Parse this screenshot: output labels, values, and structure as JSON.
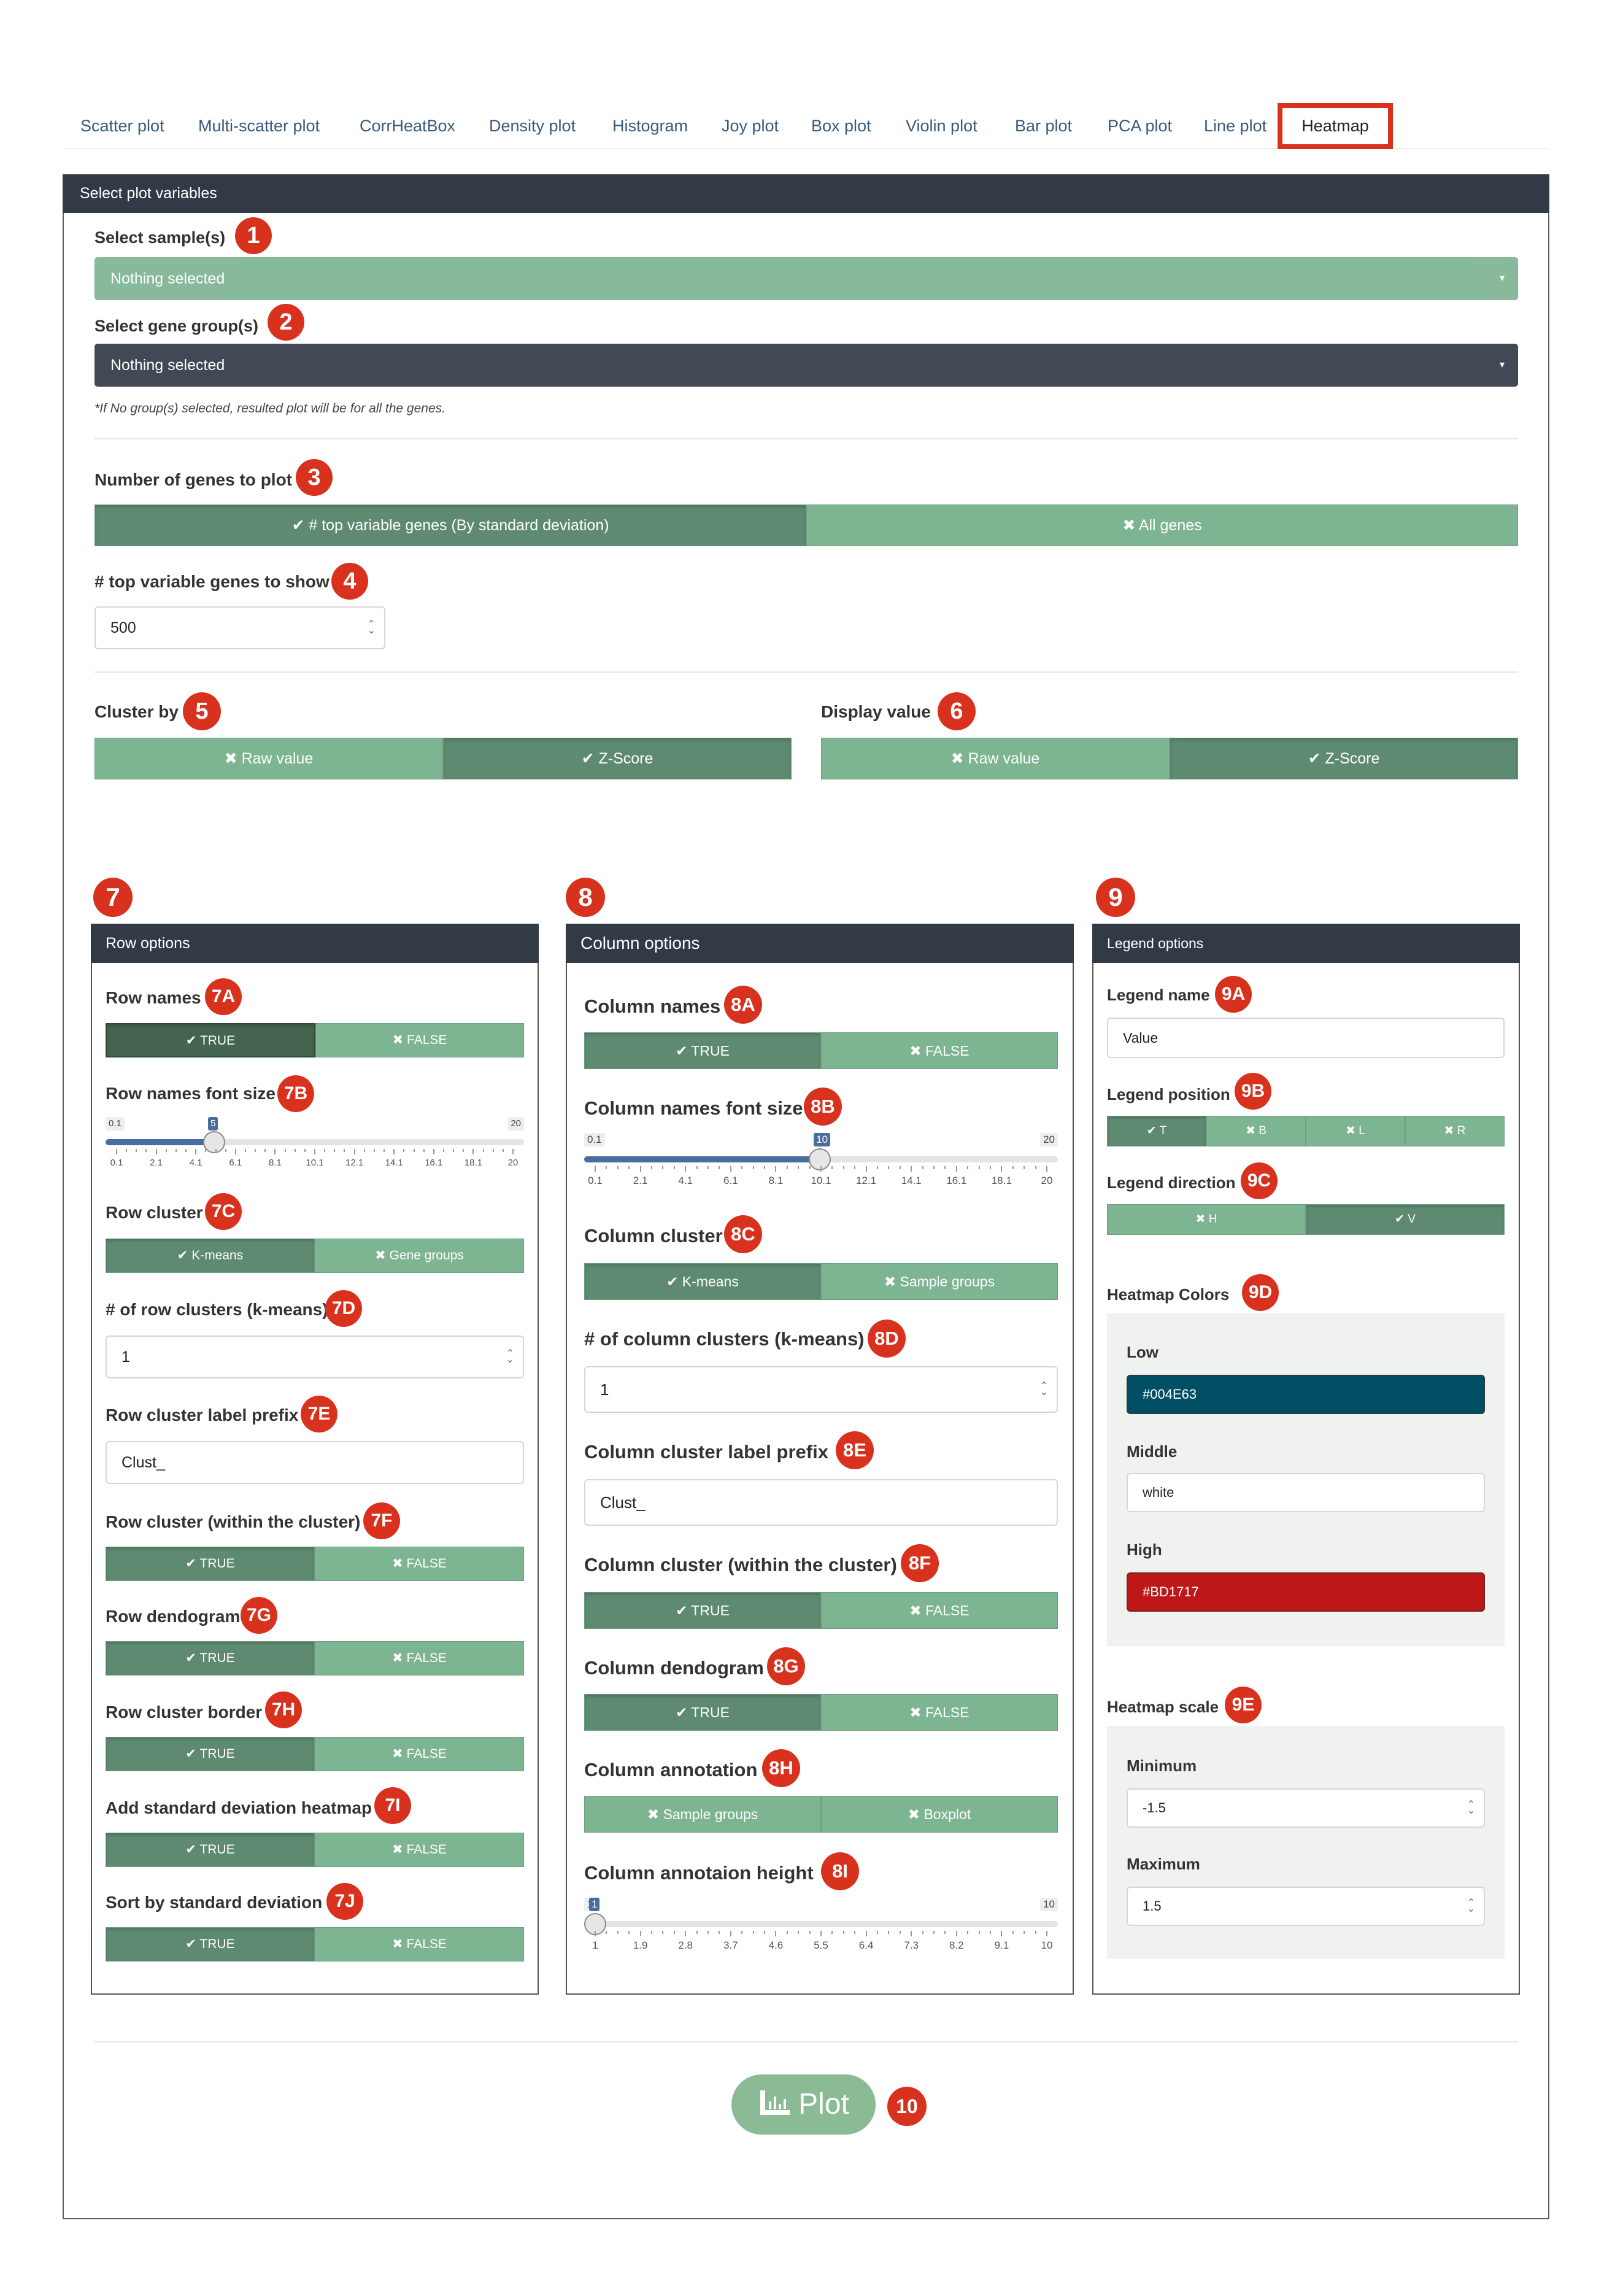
{
  "tabs": [
    "Scatter plot",
    "Multi-scatter plot",
    "CorrHeatBox",
    "Density plot",
    "Histogram",
    "Joy plot",
    "Box plot",
    "Violin plot",
    "Bar plot",
    "PCA plot",
    "Line plot",
    "Heatmap"
  ],
  "active_tab": "Heatmap",
  "panel_title": "Select plot variables",
  "samples": {
    "label": "Select sample(s)",
    "value": "Nothing selected",
    "badge": "1"
  },
  "gene_groups": {
    "label": "Select gene group(s)",
    "value": "Nothing selected",
    "badge": "2",
    "note": "*If No group(s) selected, resulted plot will be for all the genes."
  },
  "num_genes": {
    "label": "Number of genes to plot",
    "badge": "3",
    "options": [
      "✔ # top variable genes (By standard deviation)",
      "✖ All genes"
    ]
  },
  "top_genes": {
    "label": "# top variable genes to show",
    "badge": "4",
    "value": "500"
  },
  "cluster_by": {
    "label": "Cluster by",
    "badge": "5",
    "options": [
      "✖ Raw value",
      "✔ Z-Score"
    ]
  },
  "display_value": {
    "label": "Display value",
    "badge": "6",
    "options": [
      "✖ Raw value",
      "✔ Z-Score"
    ]
  },
  "row_options": {
    "badge": "7",
    "title": "Row options",
    "row_names": {
      "label": "Row names",
      "badge": "7A",
      "options": [
        "✔ TRUE",
        "✖ FALSE"
      ]
    },
    "font_size": {
      "label": "Row names font size",
      "badge": "7B",
      "min": "0.1",
      "max": "20",
      "value": "5",
      "value_num": 5,
      "ticks": [
        "0.1",
        "2.1",
        "4.1",
        "6.1",
        "8.1",
        "10.1",
        "12.1",
        "14.1",
        "16.1",
        "18.1",
        "20"
      ]
    },
    "row_cluster": {
      "label": "Row cluster",
      "badge": "7C",
      "options": [
        "✔ K-means",
        "✖ Gene groups"
      ]
    },
    "num_clusters": {
      "label": "# of row clusters (k-means)",
      "badge": "7D",
      "value": "1"
    },
    "prefix": {
      "label": "Row cluster label prefix",
      "badge": "7E",
      "value": "Clust_"
    },
    "within": {
      "label": "Row cluster (within the cluster)",
      "badge": "7F",
      "options": [
        "✔ TRUE",
        "✖ FALSE"
      ]
    },
    "dendogram": {
      "label": "Row dendogram",
      "badge": "7G",
      "options": [
        "✔ TRUE",
        "✖ FALSE"
      ]
    },
    "border": {
      "label": "Row cluster border",
      "badge": "7H",
      "options": [
        "✔ TRUE",
        "✖ FALSE"
      ]
    },
    "sd_heatmap": {
      "label": "Add standard deviation heatmap",
      "badge": "7I",
      "options": [
        "✔ TRUE",
        "✖ FALSE"
      ]
    },
    "sort_sd": {
      "label": "Sort by standard deviation",
      "badge": "7J",
      "options": [
        "✔ TRUE",
        "✖ FALSE"
      ]
    }
  },
  "column_options": {
    "badge": "8",
    "title": "Column options",
    "col_names": {
      "label": "Column names",
      "badge": "8A",
      "options": [
        "✔ TRUE",
        "✖ FALSE"
      ]
    },
    "font_size": {
      "label": "Column names font size",
      "badge": "8B",
      "min": "0.1",
      "max": "20",
      "value": "10",
      "value_num": 10,
      "ticks": [
        "0.1",
        "2.1",
        "4.1",
        "6.1",
        "8.1",
        "10.1",
        "12.1",
        "14.1",
        "16.1",
        "18.1",
        "20"
      ]
    },
    "col_cluster": {
      "label": "Column cluster",
      "badge": "8C",
      "options": [
        "✔ K-means",
        "✖ Sample groups"
      ]
    },
    "num_clusters": {
      "label": "# of column clusters (k-means)",
      "badge": "8D",
      "value": "1"
    },
    "prefix": {
      "label": "Column cluster label prefix",
      "badge": "8E",
      "value": "Clust_"
    },
    "within": {
      "label": "Column cluster (within the cluster)",
      "badge": "8F",
      "options": [
        "✔ TRUE",
        "✖ FALSE"
      ]
    },
    "dendogram": {
      "label": "Column dendogram",
      "badge": "8G",
      "options": [
        "✔ TRUE",
        "✖ FALSE"
      ]
    },
    "annotation": {
      "label": "Column annotation",
      "badge": "8H",
      "options": [
        "✖ Sample groups",
        "✖ Boxplot"
      ]
    },
    "annot_height": {
      "label": "Column annotaion height",
      "badge": "8I",
      "min": "1",
      "max": "10",
      "value": "1",
      "value_num": 1,
      "ticks": [
        "1",
        "1.9",
        "2.8",
        "3.7",
        "4.6",
        "5.5",
        "6.4",
        "7.3",
        "8.2",
        "9.1",
        "10"
      ]
    }
  },
  "legend_options": {
    "badge": "9",
    "title": "Legend options",
    "name": {
      "label": "Legend name",
      "badge": "9A",
      "value": "Value"
    },
    "position": {
      "label": "Legend position",
      "badge": "9B",
      "options": [
        "✔ T",
        "✖ B",
        "✖ L",
        "✖ R"
      ]
    },
    "direction": {
      "label": "Legend direction",
      "badge": "9C",
      "options": [
        "✖ H",
        "✔ V"
      ]
    },
    "colors": {
      "label": "Heatmap Colors",
      "badge": "9D",
      "low_label": "Low",
      "low": "#004E63",
      "mid_label": "Middle",
      "mid": "white",
      "high_label": "High",
      "high": "#BD1717"
    },
    "scale": {
      "label": "Heatmap scale",
      "badge": "9E",
      "min_label": "Minimum",
      "min": "-1.5",
      "max_label": "Maximum",
      "max": "1.5"
    }
  },
  "plot": {
    "label": "Plot",
    "badge": "10"
  },
  "colors": {
    "accent": "#7db492",
    "active": "#5e8a72",
    "header": "#323a46",
    "badge": "#d8321e",
    "slider": "#4b6d9e"
  }
}
